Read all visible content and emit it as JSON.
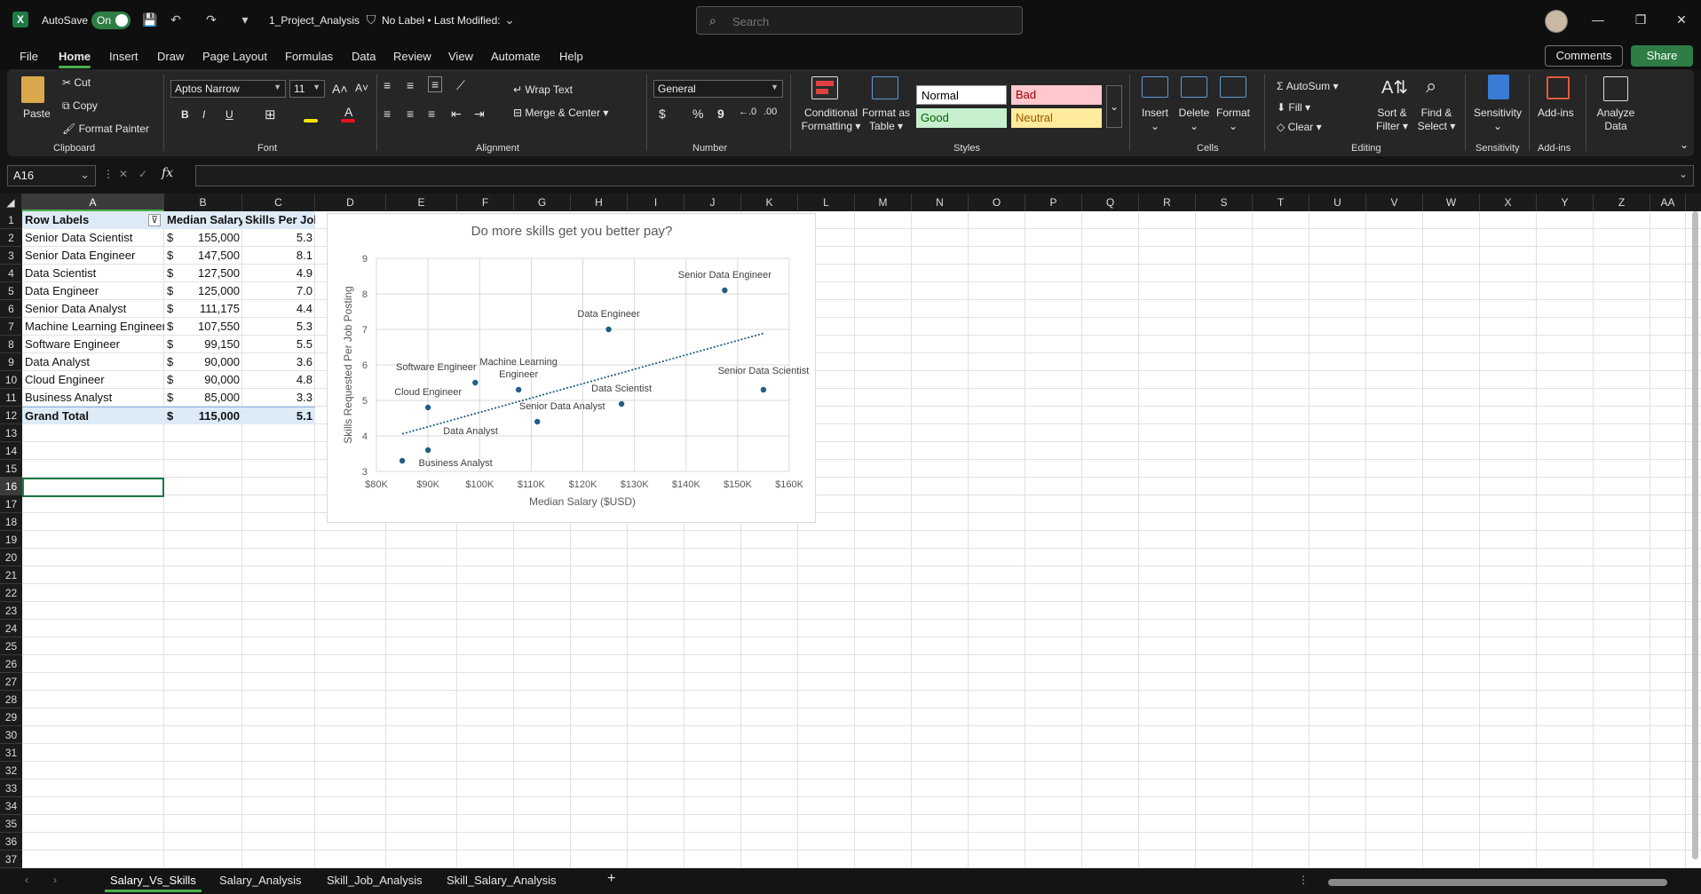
{
  "titlebar": {
    "app_icon_letter": "X",
    "autosave_label": "AutoSave",
    "autosave_state": "On",
    "document_title": "1_Project_Analysis",
    "sensitivity_label": "No Label • Last Modified:",
    "search_placeholder": "Search"
  },
  "menu": {
    "tabs": [
      "File",
      "Home",
      "Insert",
      "Draw",
      "Page Layout",
      "Formulas",
      "Data",
      "Review",
      "View",
      "Automate",
      "Help"
    ],
    "active": "Home",
    "comments_label": "Comments",
    "share_label": "Share"
  },
  "ribbon": {
    "clipboard": {
      "paste": "Paste",
      "cut": "Cut",
      "copy": "Copy",
      "format_painter": "Format Painter",
      "label": "Clipboard"
    },
    "font": {
      "name": "Aptos Narrow",
      "size": "11",
      "bold": "B",
      "italic": "I",
      "underline": "U",
      "label": "Font"
    },
    "alignment": {
      "wrap_text": "Wrap Text",
      "merge_center": "Merge & Center",
      "label": "Alignment"
    },
    "number": {
      "format": "General",
      "currency": "$",
      "percent": "%",
      "comma": "9",
      "label": "Number"
    },
    "styles": {
      "conditional_formatting": [
        "Conditional",
        "Formatting"
      ],
      "format_as_table": [
        "Format as",
        "Table"
      ],
      "cells": [
        {
          "name": "Normal",
          "bg": "#ffffff",
          "fg": "#000000"
        },
        {
          "name": "Bad",
          "bg": "#ffc7ce",
          "fg": "#9c0006"
        },
        {
          "name": "Good",
          "bg": "#c6efce",
          "fg": "#006100"
        },
        {
          "name": "Neutral",
          "bg": "#ffeb9c",
          "fg": "#9c5700"
        }
      ],
      "label": "Styles"
    },
    "cells": {
      "insert": "Insert",
      "delete": "Delete",
      "format": "Format",
      "label": "Cells"
    },
    "editing": {
      "autosum": "AutoSum",
      "fill": "Fill",
      "clear": "Clear",
      "sort_filter": [
        "Sort &",
        "Filter"
      ],
      "find_select": [
        "Find &",
        "Select"
      ],
      "label": "Editing"
    },
    "sensitivity": {
      "button": "Sensitivity",
      "label": "Sensitivity"
    },
    "addins": {
      "button": "Add-ins",
      "label": "Add-ins"
    },
    "analyze": {
      "button": [
        "Analyze",
        "Data"
      ]
    }
  },
  "formula_bar": {
    "name_box": "A16",
    "fx": "fx",
    "value": ""
  },
  "grid": {
    "columns": [
      "A",
      "B",
      "C",
      "D",
      "E",
      "F",
      "G",
      "H",
      "I",
      "J",
      "K",
      "L",
      "M",
      "N",
      "O",
      "P",
      "Q",
      "R",
      "S",
      "T",
      "U",
      "V",
      "W",
      "X",
      "Y",
      "Z",
      "AA"
    ],
    "selected_column": "A",
    "selected_row": "16",
    "rows": [
      "1",
      "2",
      "3",
      "4",
      "5",
      "6",
      "7",
      "8",
      "9",
      "10",
      "11",
      "12",
      "13",
      "14",
      "15",
      "16",
      "17",
      "18",
      "19",
      "20",
      "21",
      "22",
      "23",
      "24",
      "25",
      "26",
      "27",
      "28",
      "29",
      "30",
      "31",
      "32",
      "33",
      "34",
      "35",
      "36",
      "37"
    ],
    "pivot": {
      "headers": [
        "Row Labels",
        "Median Salary",
        "Skills Per Job"
      ],
      "currency_symbol": "$",
      "rows": [
        [
          "Senior Data Scientist",
          "155,000",
          "5.3"
        ],
        [
          "Senior Data Engineer",
          "147,500",
          "8.1"
        ],
        [
          "Data Scientist",
          "127,500",
          "4.9"
        ],
        [
          "Data Engineer",
          "125,000",
          "7.0"
        ],
        [
          "Senior Data Analyst",
          "111,175",
          "4.4"
        ],
        [
          "Machine Learning Engineer",
          "107,550",
          "5.3"
        ],
        [
          "Software Engineer",
          "99,150",
          "5.5"
        ],
        [
          "Data Analyst",
          "90,000",
          "3.6"
        ],
        [
          "Cloud Engineer",
          "90,000",
          "4.8"
        ],
        [
          "Business Analyst",
          "85,000",
          "3.3"
        ]
      ],
      "total": [
        "Grand Total",
        "115,000",
        "5.1"
      ]
    }
  },
  "chart_data": {
    "type": "scatter",
    "title": "Do more skills get you better pay?",
    "xlabel": "Median Salary ($USD)",
    "ylabel": "Skills Requested Per Job Posting",
    "xlim": [
      80000,
      160000
    ],
    "ylim": [
      3,
      9
    ],
    "x_ticks": [
      "$80K",
      "$90K",
      "$100K",
      "$110K",
      "$120K",
      "$130K",
      "$140K",
      "$150K",
      "$160K"
    ],
    "y_ticks": [
      "3",
      "4",
      "5",
      "6",
      "7",
      "8",
      "9"
    ],
    "grid": true,
    "trendline": "linear (dotted)",
    "marker_color": "#1f5f85",
    "points": [
      {
        "label": "Senior Data Scientist",
        "x": 155000,
        "y": 5.3
      },
      {
        "label": "Senior Data Engineer",
        "x": 147500,
        "y": 8.1
      },
      {
        "label": "Data Scientist",
        "x": 127500,
        "y": 4.9
      },
      {
        "label": "Data Engineer",
        "x": 125000,
        "y": 7.0
      },
      {
        "label": "Senior Data Analyst",
        "x": 111175,
        "y": 4.4
      },
      {
        "label": "Machine Learning Engineer",
        "x": 107550,
        "y": 5.3
      },
      {
        "label": "Software Engineer",
        "x": 99150,
        "y": 5.5
      },
      {
        "label": "Data Analyst",
        "x": 90000,
        "y": 3.6
      },
      {
        "label": "Cloud Engineer",
        "x": 90000,
        "y": 4.8
      },
      {
        "label": "Business Analyst",
        "x": 85000,
        "y": 3.3
      }
    ]
  },
  "sheet_tabs": {
    "tabs": [
      "Salary_Vs_Skills",
      "Salary_Analysis",
      "Skill_Job_Analysis",
      "Skill_Salary_Analysis"
    ],
    "active": "Salary_Vs_Skills",
    "add_label": "+"
  }
}
